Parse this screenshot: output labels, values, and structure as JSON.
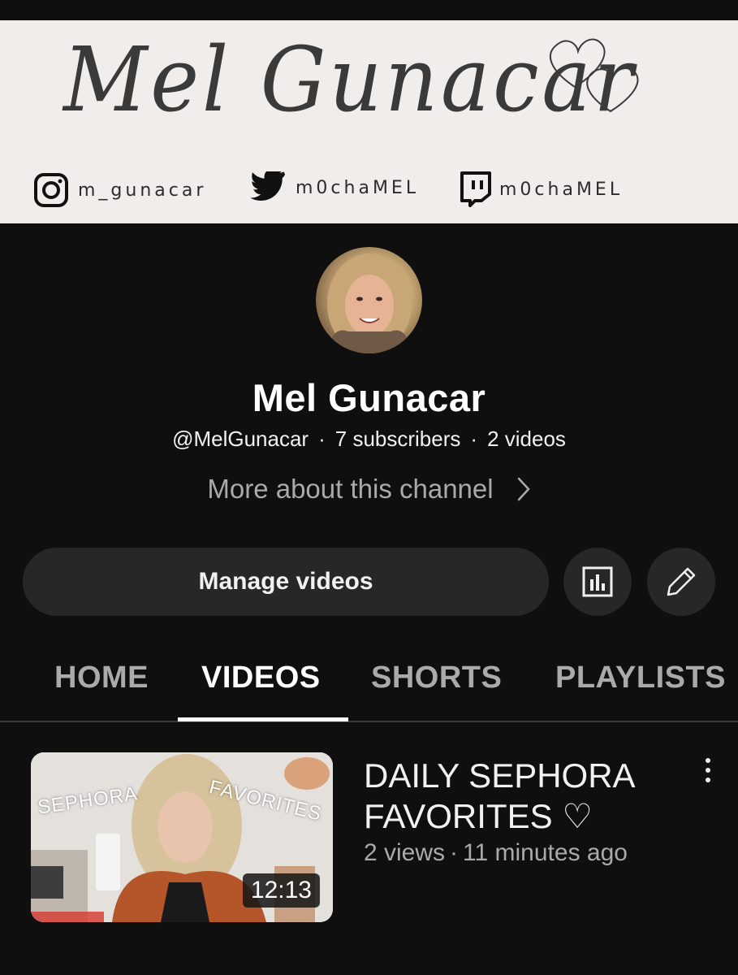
{
  "banner": {
    "title": "Mel Gunacar",
    "instagram_handle": "m_gunacar",
    "twitter_handle": "m0chaMEL",
    "twitch_handle": "m0chaMEL"
  },
  "channel": {
    "name": "Mel Gunacar",
    "handle": "@MelGunacar",
    "subscribers": "7 subscribers",
    "videos_count": "2 videos",
    "more_about": "More about this channel"
  },
  "actions": {
    "manage_videos": "Manage videos",
    "analytics_icon": "analytics-icon",
    "edit_icon": "pencil-icon"
  },
  "tabs": [
    {
      "label": "HOME",
      "active": false
    },
    {
      "label": "VIDEOS",
      "active": true
    },
    {
      "label": "SHORTS",
      "active": false
    },
    {
      "label": "PLAYLISTS",
      "active": false
    }
  ],
  "videos": [
    {
      "title": "DAILY SEPHORA FAVORITES ♡",
      "views": "2 views",
      "age": "11 minutes ago",
      "duration": "12:13",
      "thumb_text_left": "SEPHORA",
      "thumb_text_right": "FAVORITES"
    }
  ],
  "colors": {
    "background": "#0f0f0f",
    "banner_bg": "#f1edea",
    "button_bg": "#272727",
    "secondary_text": "#aaaaaa"
  }
}
